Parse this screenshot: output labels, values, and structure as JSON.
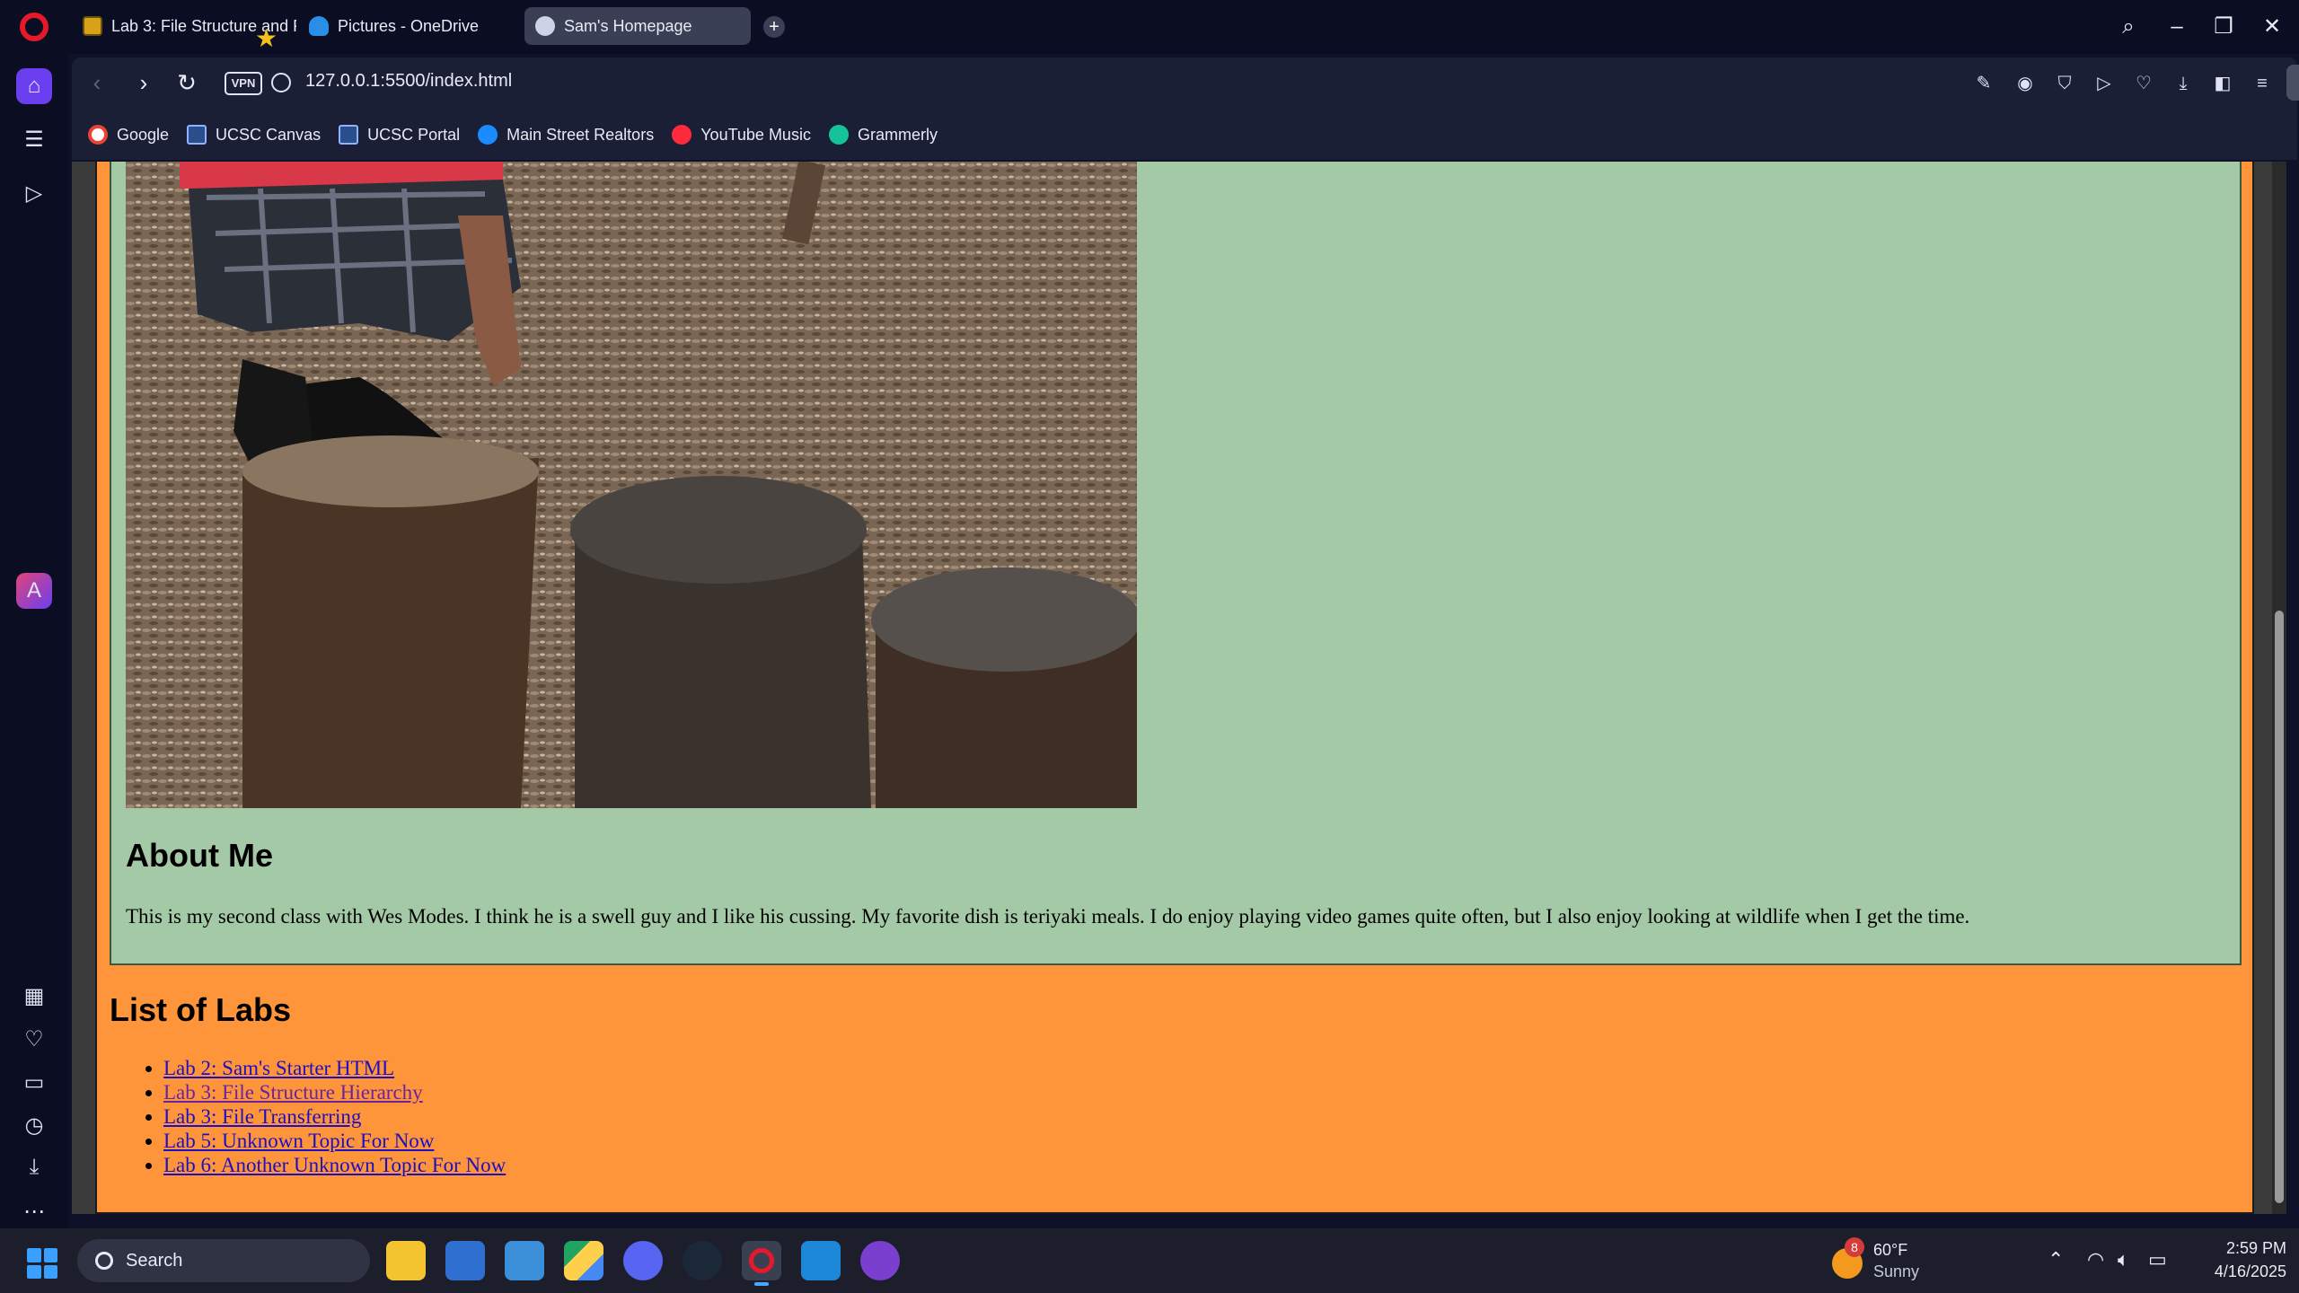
{
  "browser": {
    "tabs": [
      {
        "label": "Lab 3: File Structure and Fi"
      },
      {
        "label": "Pictures - OneDrive"
      },
      {
        "label": "Sam's Homepage"
      }
    ],
    "vpn_label": "VPN",
    "url": "127.0.0.1:5500/index.html",
    "bookmarks": [
      {
        "label": "Google",
        "icon": "google-icon"
      },
      {
        "label": "UCSC Canvas",
        "icon": "ucsc-icon"
      },
      {
        "label": "UCSC Portal",
        "icon": "ucsc-icon"
      },
      {
        "label": "Main Street Realtors",
        "icon": "realtor-icon"
      },
      {
        "label": "YouTube Music",
        "icon": "youtube-music-icon"
      },
      {
        "label": "Grammerly",
        "icon": "grammarly-icon"
      }
    ]
  },
  "page": {
    "about_title": "About Me",
    "about_text": "This is my second class with Wes Modes. I think he is a swell guy and I like his cussing. My favorite dish is teriyaki meals. I do enjoy playing video games quite often, but I also enjoy looking at wildlife when I get the time.",
    "labs_title": "List of Labs",
    "labs": [
      {
        "label": "Lab 2: Sam's Starter HTML",
        "visited": false
      },
      {
        "label": "Lab 3: File Structure Hierarchy",
        "visited": true
      },
      {
        "label": "Lab 3: File Transferring",
        "visited": false
      },
      {
        "label": "Lab 5: Unknown Topic For Now",
        "visited": false
      },
      {
        "label": "Lab 6: Another Unknown Topic For Now",
        "visited": false
      }
    ],
    "colors": {
      "page_bg": "#fe953b",
      "panel_bg": "#a4c9a6",
      "link": "#1d0ec4",
      "link_visited": "#6a23a0"
    }
  },
  "taskbar": {
    "search_label": "Search",
    "weather": {
      "badge": "8",
      "temp": "60°F",
      "condition": "Sunny"
    },
    "clock": {
      "time": "2:59 PM",
      "date": "4/16/2025"
    }
  }
}
